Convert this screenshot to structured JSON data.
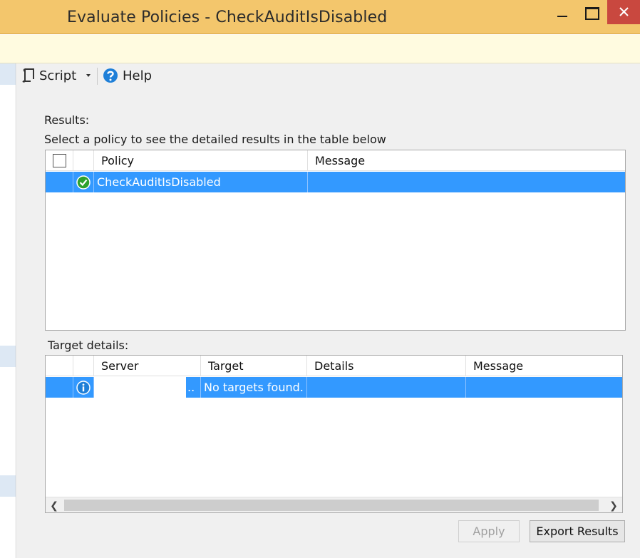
{
  "window": {
    "title": "Evaluate Policies - CheckAuditIsDisabled"
  },
  "toolbar": {
    "script_label": "Script",
    "help_label": "Help"
  },
  "results": {
    "heading": "Results:",
    "instruction": "Select a policy to see the detailed results in the table below",
    "columns": [
      "Policy",
      "Message"
    ],
    "rows": [
      {
        "policy": "CheckAuditIsDisabled",
        "message": "",
        "status": "success-icon"
      }
    ]
  },
  "target_details": {
    "heading": "Target details:",
    "columns": [
      "Server",
      "Target",
      "Details",
      "Message"
    ],
    "rows": [
      {
        "server": "",
        "server_overflow": "..",
        "target": "No targets found.",
        "details": "",
        "message": "",
        "status": "info-icon"
      }
    ]
  },
  "buttons": {
    "apply_label": "Apply",
    "export_label": "Export Results"
  },
  "colors": {
    "titlebar": "#f3c66c",
    "selection": "#3399ff",
    "close": "#c9483f",
    "success": "#2ea12e",
    "info": "#1e7fd8"
  }
}
